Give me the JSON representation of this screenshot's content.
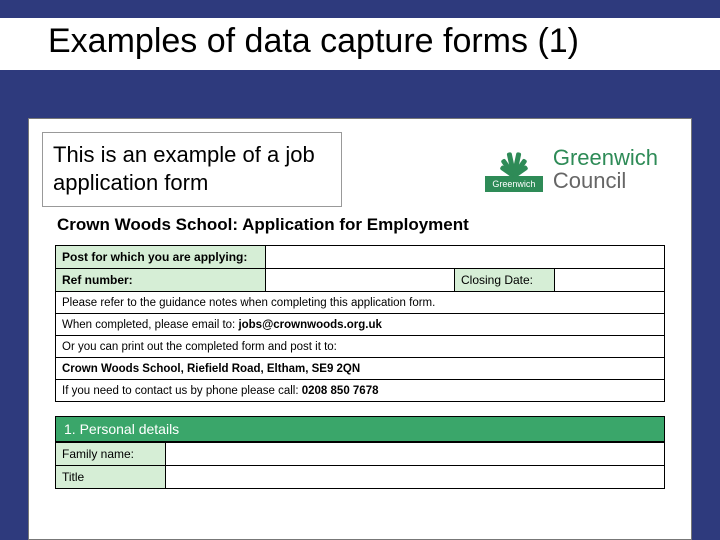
{
  "slide": {
    "title": "Examples of data capture forms (1)",
    "caption": "This is an example of a job application form"
  },
  "logo": {
    "mark_text": "Greenwich",
    "line1": "Greenwich",
    "line2": "Council"
  },
  "form": {
    "heading": "Crown Woods School: Application for Employment",
    "post_label": "Post for which you are applying:",
    "ref_label": "Ref number:",
    "closing_label": "Closing Date:",
    "instructions": {
      "line1": "Please refer to the guidance notes when completing this application form.",
      "line2_pre": "When completed, please email to: ",
      "line2_bold": "jobs@crownwoods.org.uk",
      "line3": "Or you can print out the completed form and post it to:",
      "line4": "Crown Woods School, Riefield Road, Eltham, SE9 2QN",
      "line5_pre": "If you need to contact us by phone please call: ",
      "line5_bold": "0208 850 7678"
    },
    "section1": "1. Personal details",
    "family_label": "Family name:",
    "title_label": "Title"
  }
}
